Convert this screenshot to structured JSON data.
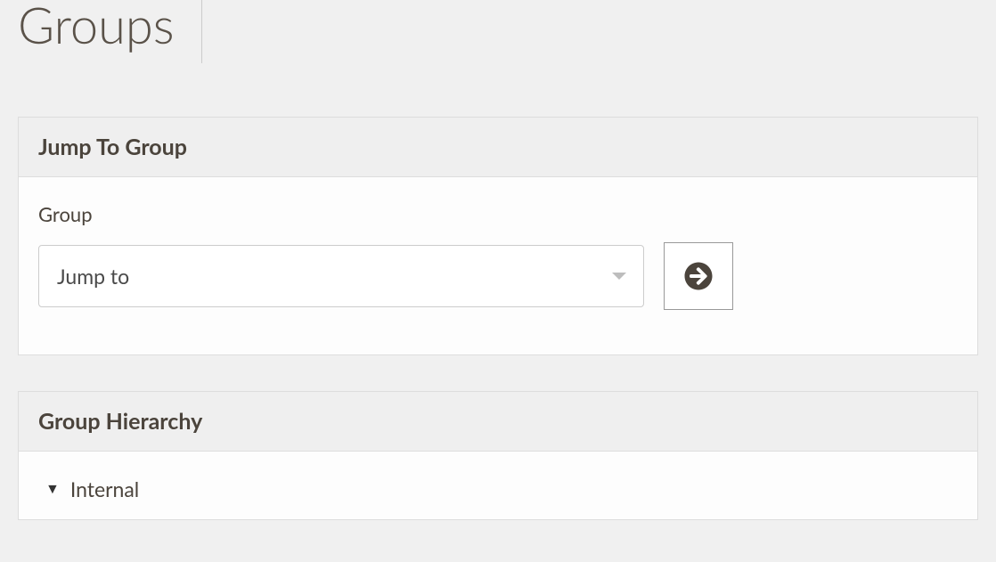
{
  "page": {
    "title": "Groups"
  },
  "jumpPanel": {
    "title": "Jump To Group",
    "label": "Group",
    "selectPlaceholder": "Jump to"
  },
  "hierarchyPanel": {
    "title": "Group Hierarchy",
    "rootItem": "Internal"
  }
}
